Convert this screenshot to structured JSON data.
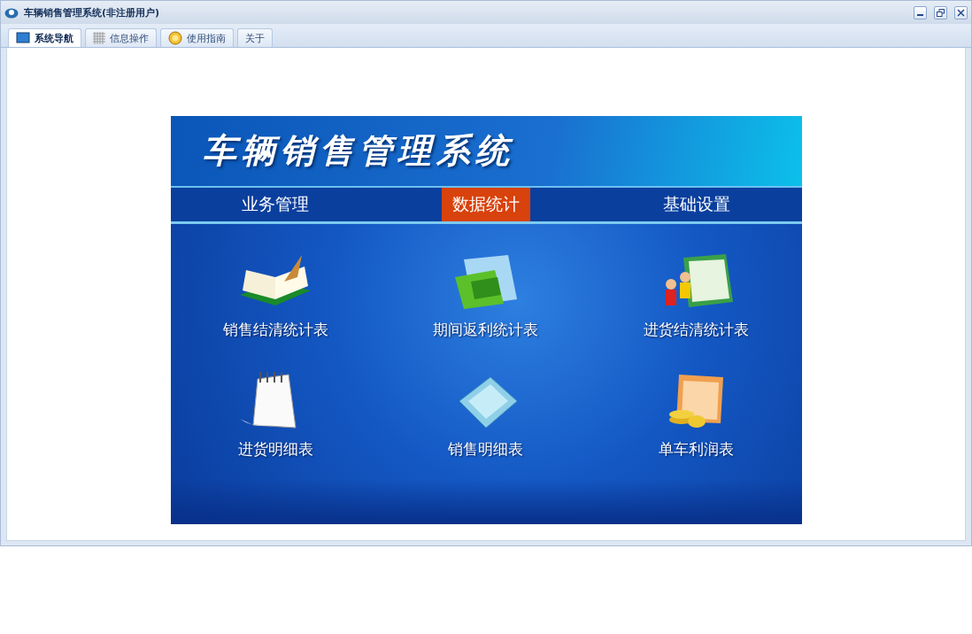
{
  "window": {
    "title": "车辆销售管理系统(非注册用户)"
  },
  "tabs": [
    {
      "label": "系统导航",
      "selected": true,
      "kind": "monitor"
    },
    {
      "label": "信息操作",
      "selected": false,
      "kind": "grid"
    },
    {
      "label": "使用指南",
      "selected": false,
      "kind": "help"
    },
    {
      "label": "关于",
      "selected": false,
      "kind": "none"
    }
  ],
  "banner": {
    "title": "车辆销售管理系统",
    "menu": [
      {
        "label": "业务管理",
        "selected": false
      },
      {
        "label": "数据统计",
        "selected": true
      },
      {
        "label": "基础设置",
        "selected": false
      }
    ],
    "items": [
      {
        "label": "销售结清统计表",
        "kind": "book"
      },
      {
        "label": "期间返利统计表",
        "kind": "folder-green"
      },
      {
        "label": "进货结清统计表",
        "kind": "people-folder"
      },
      {
        "label": "进货明细表",
        "kind": "notepad"
      },
      {
        "label": "销售明细表",
        "kind": "folder-blue"
      },
      {
        "label": "单车利润表",
        "kind": "coins-folder"
      }
    ]
  }
}
